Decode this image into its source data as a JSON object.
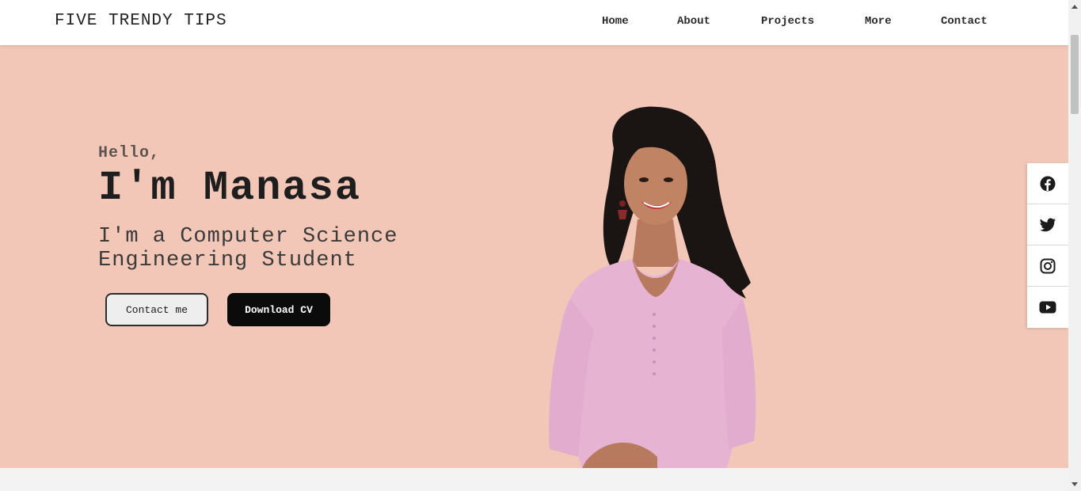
{
  "brand": "FIVE TRENDY TIPS",
  "nav": [
    {
      "label": "Home"
    },
    {
      "label": "About"
    },
    {
      "label": "Projects"
    },
    {
      "label": "More"
    },
    {
      "label": "Contact"
    }
  ],
  "hero": {
    "greeting": "Hello,",
    "name": "I'm Manasa",
    "tagline": "I'm a Computer Science Engineering Student",
    "contact_button": "Contact me",
    "cv_button": "Download CV",
    "background": "#f2c7b7"
  },
  "social": [
    {
      "icon": "facebook-icon"
    },
    {
      "icon": "twitter-icon"
    },
    {
      "icon": "instagram-icon"
    },
    {
      "icon": "youtube-icon"
    }
  ],
  "colors": {
    "accent": "#0b0b0b",
    "navbar": "#ffffff",
    "page_bottom": "#f3f3f3"
  }
}
